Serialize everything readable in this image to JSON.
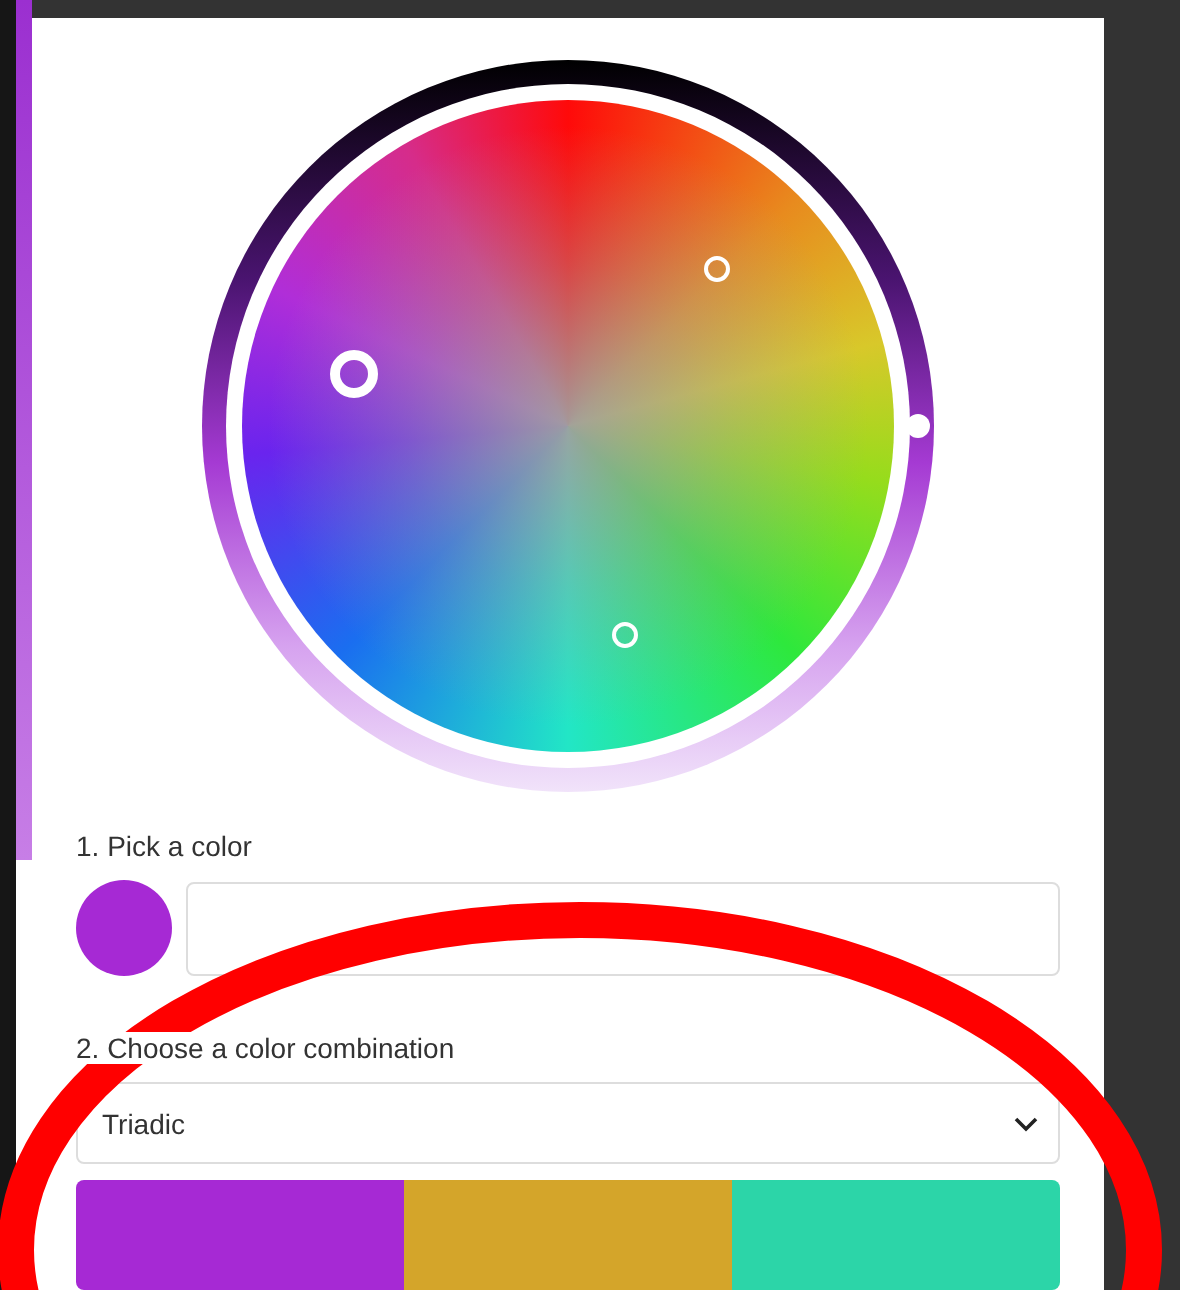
{
  "pick_color": {
    "label": "1. Pick a color",
    "color": "#a629d4"
  },
  "combination": {
    "label": "2. Choose a color combination",
    "value": "Triadic"
  },
  "palette": [
    {
      "color": "#a629d4"
    },
    {
      "color": "#d4a52a"
    },
    {
      "color": "#2cd5a8"
    }
  ],
  "annotation": {
    "kind": "ellipse"
  }
}
